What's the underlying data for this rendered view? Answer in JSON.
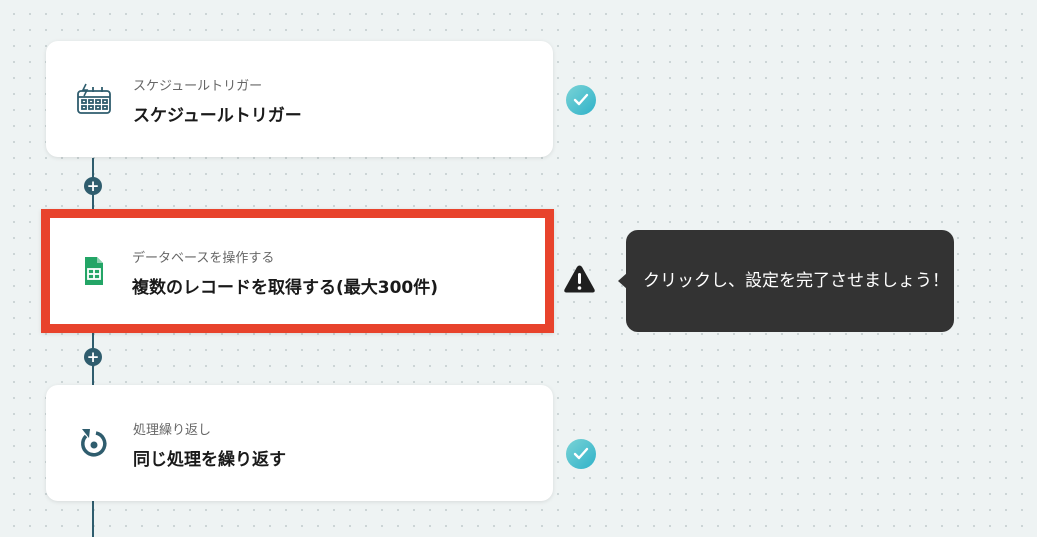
{
  "steps": [
    {
      "subtitle": "スケジュールトリガー",
      "title": "スケジュールトリガー",
      "icon": "schedule-calendar-icon",
      "status": "complete"
    },
    {
      "subtitle": "データベースを操作する",
      "title": "複数のレコードを取得する(最大300件)",
      "icon": "google-sheets-icon",
      "status": "warning"
    },
    {
      "subtitle": "処理繰り返し",
      "title": "同じ処理を繰り返す",
      "icon": "loop-repeat-icon",
      "status": "complete"
    }
  ],
  "add_step_symbol": "+",
  "tooltip": {
    "text": "クリックし、設定を完了させましょう！"
  },
  "colors": {
    "accent_border": "#e8432c",
    "connector": "#2f5d6e",
    "check": "#2fb2c9",
    "tooltip_bg": "#333333"
  }
}
